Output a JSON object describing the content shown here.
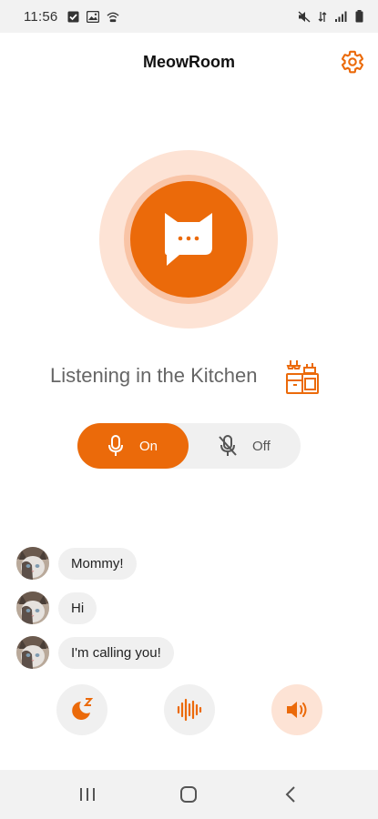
{
  "status_bar": {
    "time": "11:56",
    "left_icons": [
      "checkbox-icon",
      "image-icon",
      "wifi-calling-icon"
    ],
    "right_icons": [
      "mute-icon",
      "data-icon",
      "signal-icon",
      "battery-icon"
    ]
  },
  "header": {
    "title": "MeowRoom",
    "settings_icon": "gear-icon"
  },
  "listening": {
    "text": "Listening in the Kitchen",
    "room_icon": "kitchen-icon"
  },
  "mic_toggle": {
    "on_label": "On",
    "off_label": "Off",
    "selected": "On"
  },
  "chat": {
    "messages": [
      {
        "text": "Mommy!"
      },
      {
        "text": "Hi"
      },
      {
        "text": "I'm calling you!"
      }
    ]
  },
  "actions": [
    {
      "icon": "sleep-icon"
    },
    {
      "icon": "sound-wave-icon"
    },
    {
      "icon": "speaker-icon",
      "active": true
    }
  ],
  "colors": {
    "accent": "#eb6a0a",
    "accent_light": "#fde3d5",
    "accent_mid": "#f9c4a6",
    "bubble": "#f0f0f0"
  }
}
